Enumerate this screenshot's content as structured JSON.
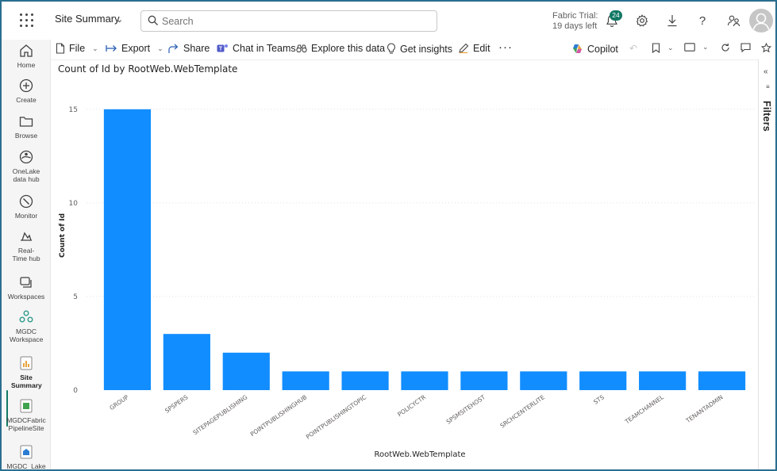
{
  "header": {
    "title": "Site Summary",
    "search_placeholder": "Search",
    "trial_line1": "Fabric Trial:",
    "trial_line2": "19 days left",
    "notification_count": "24"
  },
  "rail": {
    "items": [
      {
        "label": "Home",
        "icon": "home-icon"
      },
      {
        "label": "Create",
        "icon": "plus-circle-icon"
      },
      {
        "label": "Browse",
        "icon": "folder-icon"
      },
      {
        "label": "OneLake data hub",
        "icon": "onelake-icon"
      },
      {
        "label": "Monitor",
        "icon": "monitor-icon"
      },
      {
        "label": "Real-Time hub",
        "icon": "realtime-icon"
      },
      {
        "label": "Workspaces",
        "icon": "workspaces-icon"
      },
      {
        "label": "MGDC Workspace",
        "icon": "workspace-icon"
      },
      {
        "label": "Site Summary",
        "icon": "report-icon"
      },
      {
        "label": "MGDCFabric PipelineSite",
        "icon": "pipeline-icon"
      },
      {
        "label": "MGDC_Lake",
        "icon": "lakehouse-icon"
      }
    ]
  },
  "toolbar": {
    "file": "File",
    "export": "Export",
    "share": "Share",
    "chat_in_teams": "Chat in Teams",
    "explore": "Explore this data",
    "insights": "Get insights",
    "edit": "Edit",
    "more": "···",
    "copilot": "Copilot"
  },
  "filters": {
    "label": "Filters"
  },
  "colors": {
    "bar": "#118DFF",
    "accent": "#117865",
    "frame": "#2b6e8f"
  },
  "chart_data": {
    "type": "bar",
    "title": "Count of Id by RootWeb.WebTemplate",
    "xlabel": "RootWeb.WebTemplate",
    "ylabel": "Count of Id",
    "categories": [
      "GROUP",
      "SPSPERS",
      "SITEPAGEPUBLISHING",
      "POINTPUBLISHINGHUB",
      "POINTPUBLISHINGTOPIC",
      "POLICYCTR",
      "SPSMSITEHOST",
      "SRCHCENTERLITE",
      "STS",
      "TEAMCHANNEL",
      "TENANTADMIN"
    ],
    "values": [
      15,
      3,
      2,
      1,
      1,
      1,
      1,
      1,
      1,
      1,
      1
    ],
    "yticks": [
      0,
      5,
      10,
      15
    ],
    "ylim": [
      0,
      15.5
    ],
    "grid": true
  }
}
